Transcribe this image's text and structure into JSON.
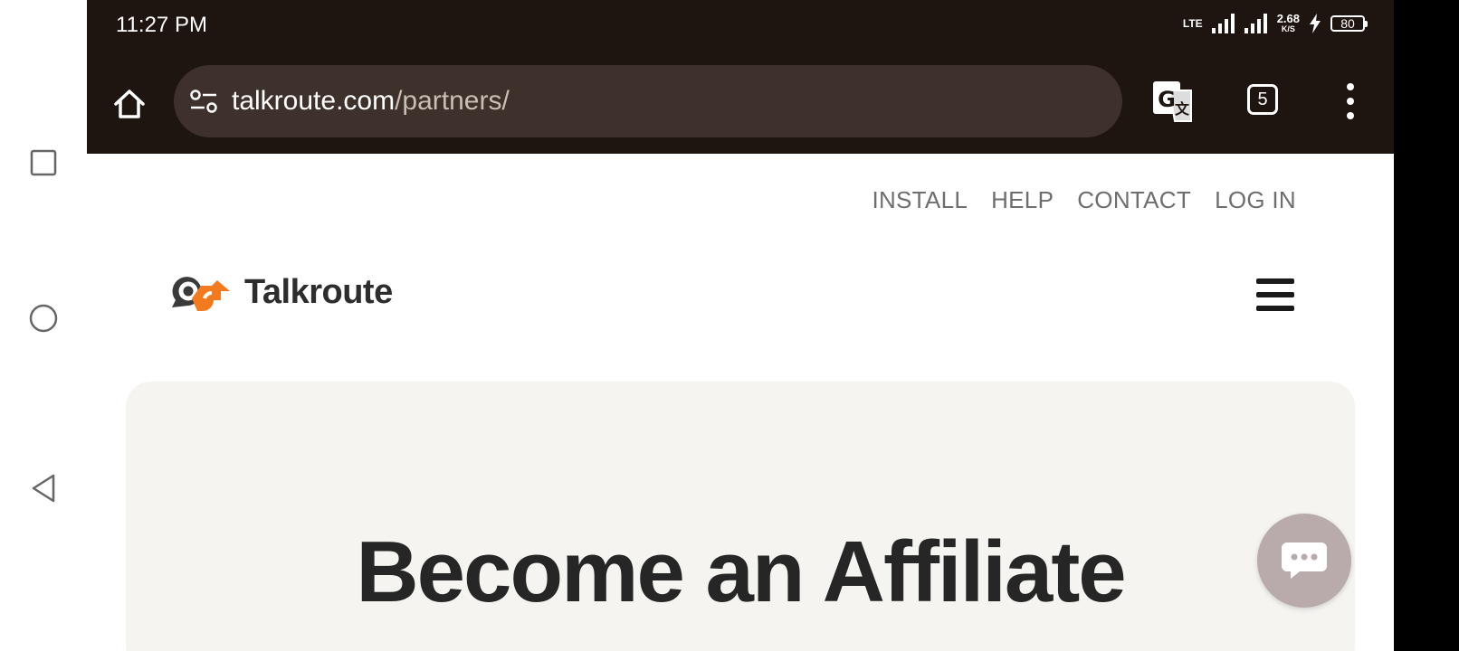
{
  "status_bar": {
    "time": "11:27 PM",
    "network_label": "LTE",
    "speed_value": "2.68",
    "speed_unit": "K/S",
    "battery": "80"
  },
  "browser": {
    "url_domain": "talkroute.com",
    "url_path": "/partners/",
    "tab_count": "5"
  },
  "page": {
    "top_nav": [
      "INSTALL",
      "HELP",
      "CONTACT",
      "LOG IN"
    ],
    "logo_text": "Talkroute",
    "hero_title": "Become an Affiliate"
  },
  "colors": {
    "chrome_bg": "#1e1410",
    "url_bar_bg": "#3e302a",
    "hero_bg": "#f5f4f1",
    "logo_orange": "#f47a20",
    "logo_dark": "#3a3a3a",
    "chat_bubble": "#b9abab"
  },
  "icons": {
    "nav_recent": "square-icon",
    "nav_home": "circle-icon",
    "nav_back": "triangle-back-icon",
    "browser_home": "home-icon",
    "site_settings": "tune-icon",
    "translate": "translate-icon",
    "menu": "more-vert-icon",
    "hamburger": "hamburger-menu-icon",
    "chat": "chat-bubble-icon"
  }
}
